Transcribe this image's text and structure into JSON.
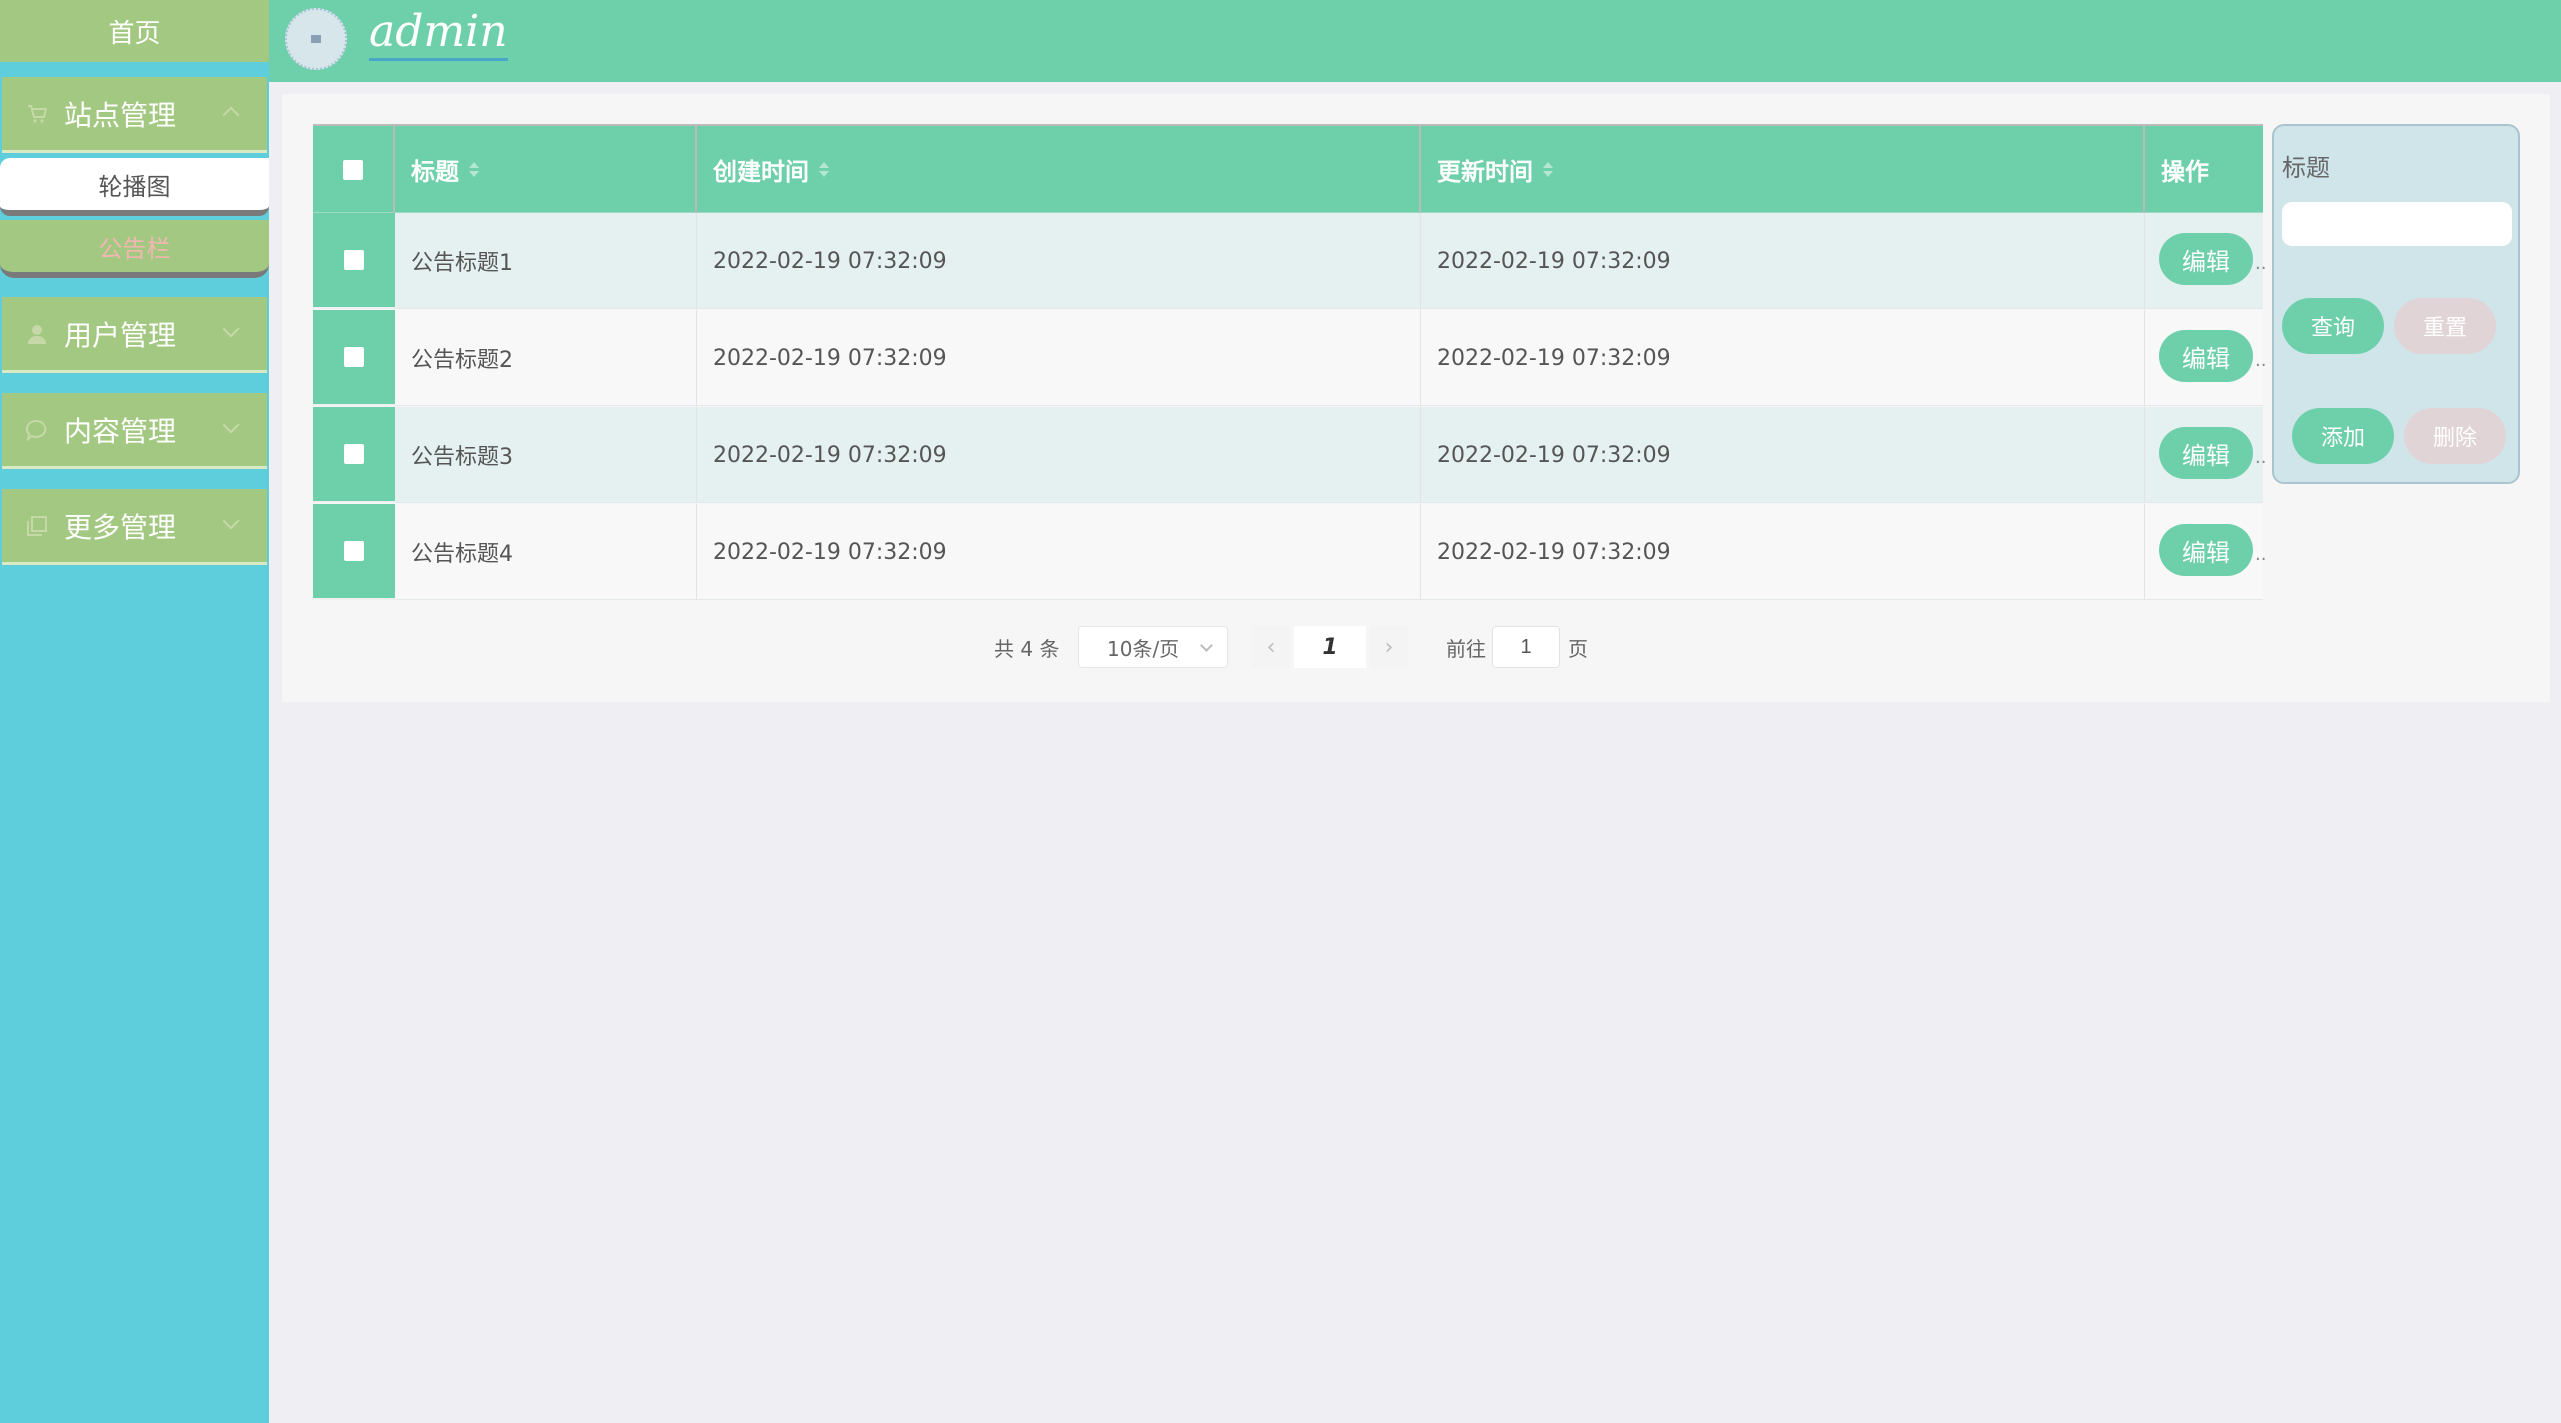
{
  "sidebar": {
    "home": "首页",
    "menus": [
      {
        "label": "站点管理",
        "icon": "cart-icon",
        "expanded": true
      },
      {
        "label": "用户管理",
        "icon": "user-icon",
        "expanded": false
      },
      {
        "label": "内容管理",
        "icon": "chat-icon",
        "expanded": false
      },
      {
        "label": "更多管理",
        "icon": "copy-icon",
        "expanded": false
      }
    ],
    "submenu": [
      {
        "label": "轮播图",
        "active": true
      },
      {
        "label": "公告栏",
        "active": false
      }
    ]
  },
  "header": {
    "username": "admin"
  },
  "table": {
    "columns": [
      "标题",
      "创建时间",
      "更新时间",
      "操作"
    ],
    "rows": [
      {
        "title": "公告标题1",
        "created": "2022-02-19 07:32:09",
        "updated": "2022-02-19 07:32:09",
        "action": "编辑"
      },
      {
        "title": "公告标题2",
        "created": "2022-02-19 07:32:09",
        "updated": "2022-02-19 07:32:09",
        "action": "编辑"
      },
      {
        "title": "公告标题3",
        "created": "2022-02-19 07:32:09",
        "updated": "2022-02-19 07:32:09",
        "action": "编辑"
      },
      {
        "title": "公告标题4",
        "created": "2022-02-19 07:32:09",
        "updated": "2022-02-19 07:32:09",
        "action": "编辑"
      }
    ],
    "overflow": ".."
  },
  "pagination": {
    "total": "共 4 条",
    "page_size": "10条/页",
    "prev": "‹",
    "current": "1",
    "next": "›",
    "goto_label": "前往",
    "goto_value": "1",
    "page_label": "页"
  },
  "search": {
    "label": "标题",
    "query_button": "查询",
    "reset_button": "重置",
    "add_button": "添加",
    "delete_button": "删除"
  },
  "colors": {
    "sidebar_bg": "#5ecedd",
    "menu_bg": "#a3c882",
    "header_bg": "#6ed0aa",
    "accent_green": "#6ed0aa",
    "disabled_pink": "#e0d4d6"
  }
}
